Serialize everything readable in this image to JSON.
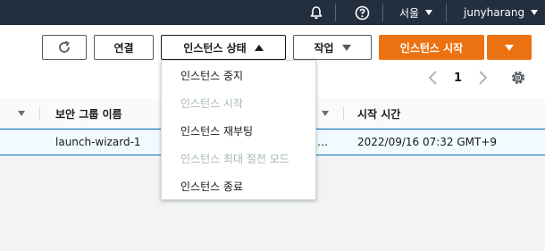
{
  "topbar": {
    "region": "서울",
    "user": "junyharang"
  },
  "toolbar": {
    "connect_label": "연결",
    "instance_state_label": "인스턴스 상태",
    "actions_label": "작업",
    "launch_label": "인스턴스 시작"
  },
  "state_menu": {
    "items": [
      {
        "label": "인스턴스 중지",
        "disabled": false
      },
      {
        "label": "인스턴스 시작",
        "disabled": true
      },
      {
        "label": "인스턴스 재부팅",
        "disabled": false
      },
      {
        "label": "인스턴스 최대 절전 모드",
        "disabled": true
      },
      {
        "label": "인스턴스 종료",
        "disabled": false
      }
    ]
  },
  "pagination": {
    "current_page": "1"
  },
  "table": {
    "columns": [
      "보안 그룹 이름",
      "시작 시간"
    ],
    "rows": [
      {
        "security_group": "launch-wizard-1",
        "truncated": "…",
        "launch_time": "2022/09/16 07:32 GMT+9"
      }
    ]
  },
  "colors": {
    "nav_bg": "#232f3e",
    "accent": "#ec7211",
    "selected_row": "#f1faff",
    "selected_border": "#0073bb"
  }
}
